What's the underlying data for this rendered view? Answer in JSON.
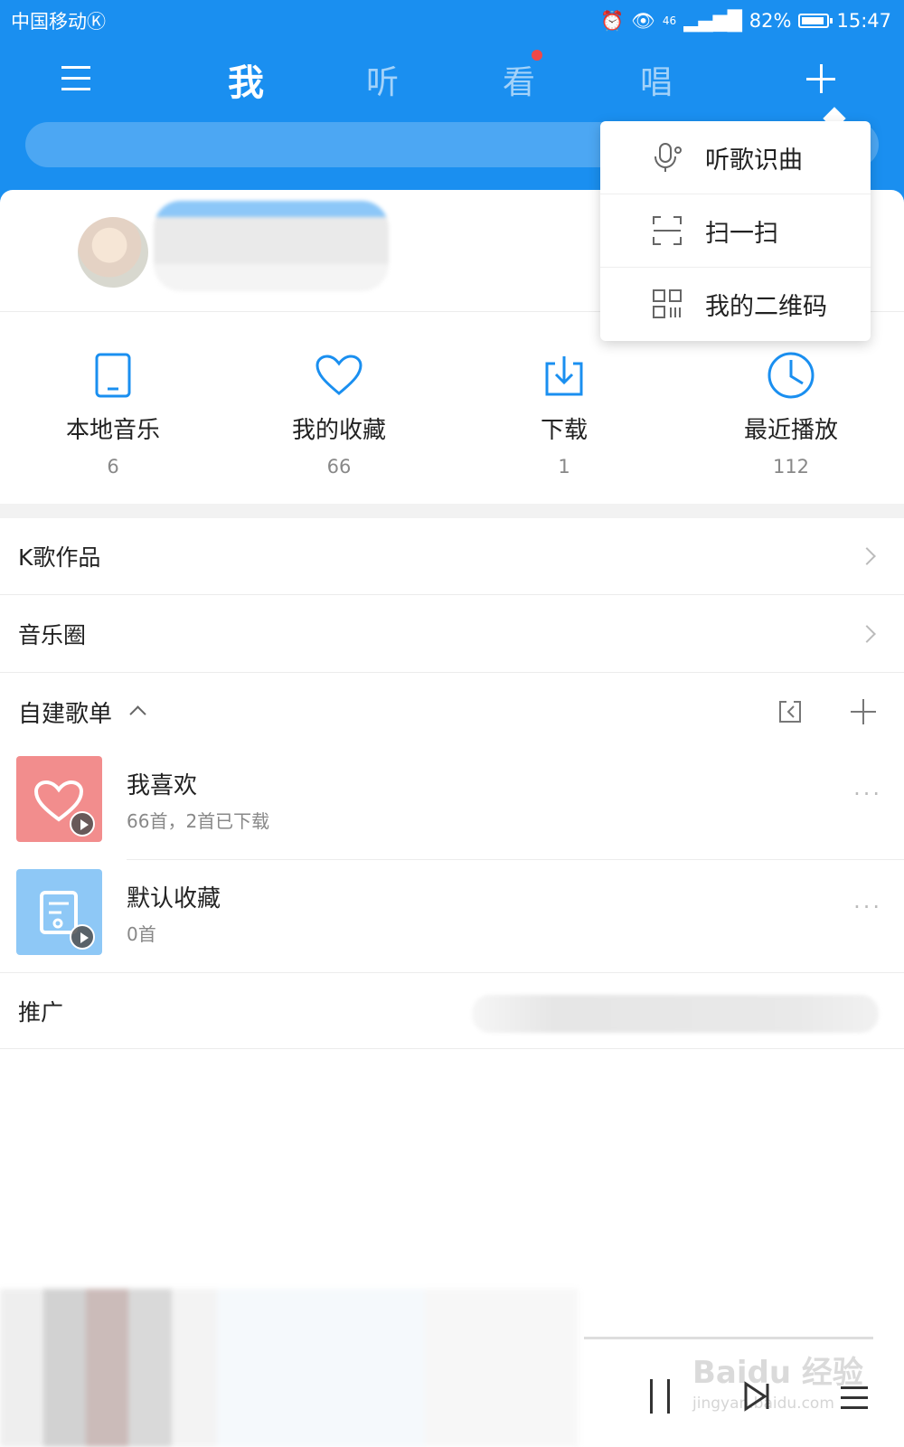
{
  "status_bar": {
    "carrier": "中国移动",
    "carrier_mark": "Ⓚ",
    "network": "46",
    "battery": "82%",
    "time": "15:47"
  },
  "nav": {
    "tabs": [
      {
        "label": "我",
        "active": true
      },
      {
        "label": "听",
        "active": false
      },
      {
        "label": "看",
        "active": false,
        "badge": true
      },
      {
        "label": "唱",
        "active": false
      }
    ]
  },
  "quick_access": [
    {
      "icon": "tablet-icon",
      "label": "本地音乐",
      "count": "6"
    },
    {
      "icon": "heart-icon",
      "label": "我的收藏",
      "count": "66"
    },
    {
      "icon": "download-icon",
      "label": "下载",
      "count": "1"
    },
    {
      "icon": "clock-icon",
      "label": "最近播放",
      "count": "112"
    }
  ],
  "rows": {
    "karaoke": "K歌作品",
    "music_circle": "音乐圈",
    "promo": "推广"
  },
  "playlists_section": {
    "title": "自建歌单"
  },
  "playlists": [
    {
      "name": "我喜欢",
      "subtitle": "66首，2首已下载",
      "more": "···"
    },
    {
      "name": "默认收藏",
      "subtitle": "0首",
      "more": "···"
    }
  ],
  "popup_menu": [
    {
      "icon": "mic-recognize-icon",
      "label": "听歌识曲"
    },
    {
      "icon": "scan-icon",
      "label": "扫一扫"
    },
    {
      "icon": "qr-code-icon",
      "label": "我的二维码"
    }
  ],
  "watermark": {
    "title": "Baidu 经验",
    "url": "jingyan.baidu.com"
  },
  "colors": {
    "brand": "#1a8ff0",
    "liked_cover": "#f28d8d",
    "default_cover": "#8ec8f6",
    "badge": "#f04848"
  }
}
